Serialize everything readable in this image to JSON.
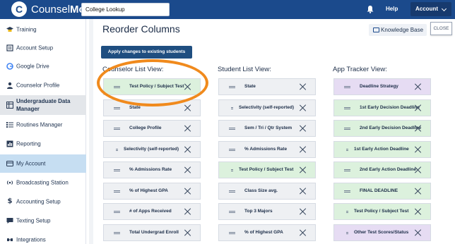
{
  "topbar": {
    "brand_prefix": "Counsel",
    "brand_suffix": "More",
    "search_value": "College Lookup",
    "help_label": "Help",
    "account_label": "Account",
    "icons": [
      "logo-icon",
      "bell-icon",
      "chevron-down-icon"
    ]
  },
  "sidebar": {
    "items": [
      {
        "label": "Training",
        "icon": "graduation-cap-icon"
      },
      {
        "label": "Account Setup",
        "icon": "building-icon"
      },
      {
        "label": "Google Drive",
        "icon": "google-icon"
      },
      {
        "label": "Counselor Profile",
        "icon": "user-icon"
      },
      {
        "label": "Undergraduate Data Manager",
        "icon": "table-icon",
        "section": true
      },
      {
        "label": "Routines Manager",
        "icon": "list-icon"
      },
      {
        "label": "Reporting",
        "icon": "chart-icon"
      },
      {
        "label": "My Account",
        "icon": "card-icon",
        "active": true
      },
      {
        "label": "Broadcasting Station",
        "icon": "broadcast-icon"
      },
      {
        "label": "Accounting Setup",
        "icon": "dollar-icon"
      },
      {
        "label": "Texting Setup",
        "icon": "message-icon"
      },
      {
        "label": "Integrations",
        "icon": "plug-icon"
      }
    ]
  },
  "main": {
    "title": "Reorder Columns",
    "knowledge_base_label": "Knowledge Base",
    "close_label": "CLOSE",
    "apply_label": "Apply changes to existing students",
    "colors": {
      "accent": "#1b4a8c",
      "green": "#dcf1dd",
      "purple": "#e6dcf3",
      "gray": "#eef0f3",
      "highlight": "#f08a1d"
    }
  },
  "columns": [
    {
      "heading": "Counselor List View:",
      "rows": [
        {
          "label": "Test Policy / Subject Test",
          "style": "green"
        },
        {
          "label": "State",
          "style": "gray"
        },
        {
          "label": "College Profile",
          "style": "gray"
        },
        {
          "label": "Selectivity (self-reported)",
          "style": "gray",
          "small_handle": true
        },
        {
          "label": "% Admissions Rate",
          "style": "gray"
        },
        {
          "label": "% of Highest GPA",
          "style": "gray"
        },
        {
          "label": "# of Apps Received",
          "style": "gray"
        },
        {
          "label": "Total Undergrad Enroll",
          "style": "gray"
        }
      ]
    },
    {
      "heading": "Student List View:",
      "rows": [
        {
          "label": "State",
          "style": "gray"
        },
        {
          "label": "Selectivity (self-reported)",
          "style": "gray",
          "small_handle": true
        },
        {
          "label": "Sem / Tri / Qtr System",
          "style": "gray"
        },
        {
          "label": "% Admissions Rate",
          "style": "gray"
        },
        {
          "label": "Test Policy / Subject Test",
          "style": "green",
          "small_handle": true
        },
        {
          "label": "Class Size avg.",
          "style": "gray"
        },
        {
          "label": "Top 3 Majors",
          "style": "gray"
        },
        {
          "label": "% of Highest GPA",
          "style": "gray"
        }
      ]
    },
    {
      "heading": "App Tracker View:",
      "rows": [
        {
          "label": "Deadline Strategy",
          "style": "purple"
        },
        {
          "label": "1st Early Decision Deadline",
          "style": "green"
        },
        {
          "label": "2nd Early Decision Deadline",
          "style": "green"
        },
        {
          "label": "1st Early Action Deadline",
          "style": "green",
          "small_handle": true
        },
        {
          "label": "2nd Early Action Deadline",
          "style": "green"
        },
        {
          "label": "FINAL DEADLINE",
          "style": "green"
        },
        {
          "label": "Test Policy / Subject Test",
          "style": "green",
          "small_handle": true
        },
        {
          "label": "Other Test Scores/Status",
          "style": "purple",
          "small_handle": true
        }
      ]
    }
  ]
}
